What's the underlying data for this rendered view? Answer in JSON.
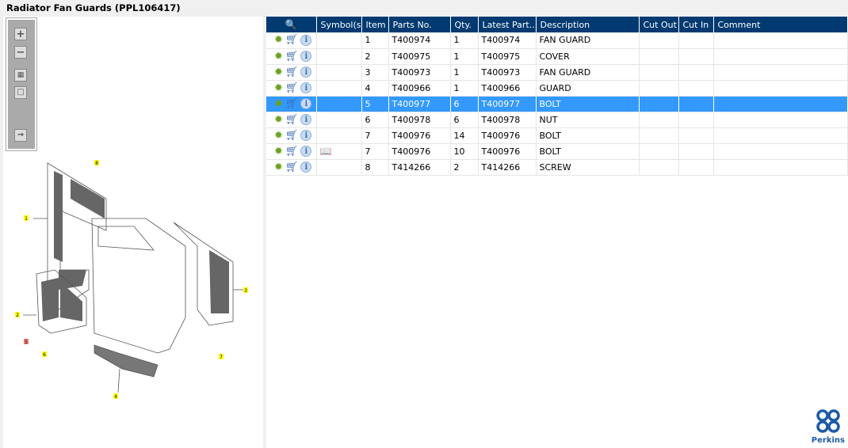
{
  "title": "Radiator Fan Guards (PPL106417)",
  "toolbar": {
    "zoom_in": "zoom-in",
    "zoom_out": "zoom-out",
    "fit": "fit",
    "single": "single"
  },
  "table": {
    "headers": [
      "",
      "Symbol(s)",
      "Item",
      "Parts No.",
      "Qty.",
      "Latest Part...",
      "Description",
      "Cut Out",
      "Cut In",
      "Comment"
    ],
    "rows": [
      {
        "symbol": "",
        "item": "1",
        "part": "T400974",
        "qty": "1",
        "latest": "T400974",
        "desc": "FAN GUARD",
        "cut_out": "",
        "cut_in": "",
        "comment": ""
      },
      {
        "symbol": "",
        "item": "2",
        "part": "T400975",
        "qty": "1",
        "latest": "T400975",
        "desc": "COVER",
        "cut_out": "",
        "cut_in": "",
        "comment": ""
      },
      {
        "symbol": "",
        "item": "3",
        "part": "T400973",
        "qty": "1",
        "latest": "T400973",
        "desc": "FAN GUARD",
        "cut_out": "",
        "cut_in": "",
        "comment": ""
      },
      {
        "symbol": "",
        "item": "4",
        "part": "T400966",
        "qty": "1",
        "latest": "T400966",
        "desc": "GUARD",
        "cut_out": "",
        "cut_in": "",
        "comment": ""
      },
      {
        "symbol": "",
        "item": "5",
        "part": "T400977",
        "qty": "6",
        "latest": "T400977",
        "desc": "BOLT",
        "cut_out": "",
        "cut_in": "",
        "comment": "",
        "selected": true
      },
      {
        "symbol": "",
        "item": "6",
        "part": "T400978",
        "qty": "6",
        "latest": "T400978",
        "desc": "NUT",
        "cut_out": "",
        "cut_in": "",
        "comment": ""
      },
      {
        "symbol": "",
        "item": "7",
        "part": "T400976",
        "qty": "14",
        "latest": "T400976",
        "desc": "BOLT",
        "cut_out": "",
        "cut_in": "",
        "comment": ""
      },
      {
        "symbol": "book-search-icon",
        "item": "7",
        "part": "T400976",
        "qty": "10",
        "latest": "T400976",
        "desc": "BOLT",
        "cut_out": "",
        "cut_in": "",
        "comment": ""
      },
      {
        "symbol": "",
        "item": "8",
        "part": "T414266",
        "qty": "2",
        "latest": "T414266",
        "desc": "SCREW",
        "cut_out": "",
        "cut_in": "",
        "comment": ""
      }
    ]
  },
  "diagram": {
    "callouts": [
      "1",
      "2",
      "3",
      "4",
      "5",
      "6",
      "7",
      "8"
    ]
  },
  "logo": {
    "text": "Perkins"
  },
  "colors": {
    "header": "#003a70",
    "selected": "#3399ff",
    "callout": "#ffff00",
    "callout_selected": "#f08080"
  }
}
